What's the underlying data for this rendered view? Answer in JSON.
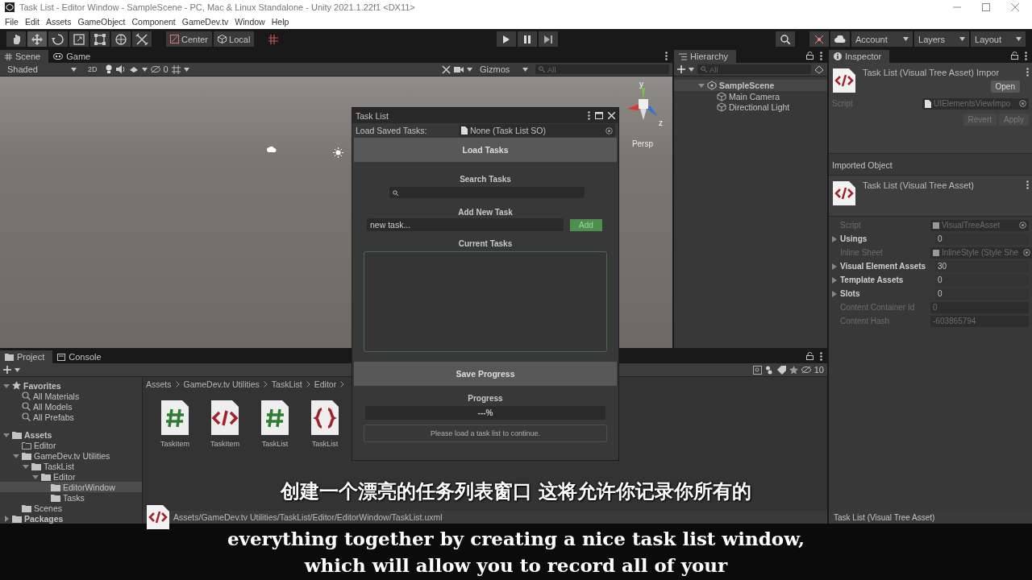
{
  "window": {
    "title": "Task List - Editor Window - SampleScene - PC, Mac & Linux Standalone - Unity 2021.1.22f1 <DX11>"
  },
  "menu": [
    "File",
    "Edit",
    "Assets",
    "GameObject",
    "Component",
    "GameDev.tv",
    "Window",
    "Help"
  ],
  "toolbar": {
    "tools": [
      {
        "selected": false
      },
      {
        "selected": true
      },
      {
        "selected": false
      },
      {
        "selected": false
      },
      {
        "selected": false
      },
      {
        "selected": false
      },
      {
        "selected": false
      }
    ],
    "pivot": "Center",
    "space": "Local",
    "account": "Account",
    "layers": "Layers",
    "layout": "Layout"
  },
  "scene_panel": {
    "tabs": [
      {
        "label": "Scene",
        "selected": true
      },
      {
        "label": "Game",
        "selected": false
      }
    ],
    "shading": "Shaded",
    "mode_2d": "2D",
    "hidden_count": "0",
    "gizmos": "Gizmos",
    "search_placeholder": "All",
    "gizmo_labels": [
      "y",
      "z"
    ],
    "projection": "Persp"
  },
  "hierarchy": {
    "title": "Hierarchy",
    "search_placeholder": "All",
    "items": [
      {
        "label": "SampleScene",
        "expanded": true,
        "children": [
          {
            "label": "Main Camera"
          },
          {
            "label": "Directional Light"
          }
        ]
      }
    ]
  },
  "inspector": {
    "title": "Inspector",
    "asset_title": "Task List (Visual Tree Asset) Impor",
    "open_button": "Open",
    "script_label": "Script",
    "script_value": "UIElementsViewImpo",
    "revert_button": "Revert",
    "apply_button": "Apply",
    "section": "Imported Object",
    "object_title": "Task List (Visual Tree Asset)",
    "properties": [
      {
        "label": "Script",
        "value": "VisualTreeAsset",
        "kind": "object",
        "disabled": true
      },
      {
        "label": "Usings",
        "value": "0",
        "kind": "foldout",
        "disabled": false
      },
      {
        "label": "Inline Sheet",
        "value": "InlineStyle (Style She",
        "kind": "object",
        "disabled": true
      },
      {
        "label": "Visual Element Assets",
        "value": "30",
        "kind": "foldout",
        "disabled": false
      },
      {
        "label": "Template Assets",
        "value": "0",
        "kind": "foldout",
        "disabled": false
      },
      {
        "label": "Slots",
        "value": "0",
        "kind": "foldout",
        "disabled": false
      },
      {
        "label": "Content Container Id",
        "value": "0",
        "kind": "field",
        "disabled": true
      },
      {
        "label": "Content Hash",
        "value": "-603865794",
        "kind": "field",
        "disabled": true
      }
    ],
    "footer": "Task List (Visual Tree Asset)"
  },
  "project": {
    "tabs": [
      {
        "label": "Project",
        "selected": true
      },
      {
        "label": "Console",
        "selected": false
      }
    ],
    "tree": [
      {
        "label": "Favorites",
        "kind": "favorites",
        "expanded": true,
        "selected": false,
        "children": [
          {
            "label": "All Materials",
            "kind": "search",
            "selected": false
          },
          {
            "label": "All Models",
            "kind": "search",
            "selected": false
          },
          {
            "label": "All Prefabs",
            "kind": "search",
            "selected": false
          }
        ]
      },
      {
        "label": "Assets",
        "kind": "root",
        "expanded": true,
        "selected": false,
        "children": [
          {
            "label": "Editor",
            "kind": "empty-folder",
            "selected": false
          },
          {
            "label": "GameDev.tv Utilities",
            "kind": "folder",
            "expanded": true,
            "selected": false,
            "children": [
              {
                "label": "TaskList",
                "kind": "folder",
                "expanded": true,
                "selected": false,
                "children": [
                  {
                    "label": "Editor",
                    "kind": "folder",
                    "expanded": true,
                    "selected": false,
                    "children": [
                      {
                        "label": "EditorWindow",
                        "kind": "folder",
                        "selected": true
                      },
                      {
                        "label": "Tasks",
                        "kind": "folder",
                        "selected": false
                      }
                    ]
                  }
                ]
              }
            ]
          },
          {
            "label": "Scenes",
            "kind": "folder",
            "selected": false
          }
        ]
      },
      {
        "label": "Packages",
        "kind": "root",
        "expanded": false,
        "selected": false
      }
    ],
    "breadcrumb": [
      "Assets",
      "GameDev.tv Utilities",
      "TaskList",
      "Editor"
    ],
    "hidden_count": "10",
    "files": [
      {
        "name": "TaskItem",
        "kind": "script"
      },
      {
        "name": "TaskItem",
        "kind": "uxml"
      },
      {
        "name": "TaskList",
        "kind": "script"
      },
      {
        "name": "TaskList",
        "kind": "uss"
      }
    ],
    "path": "Assets/GameDev.tv Utilities/TaskList/Editor/EditorWindow/TaskList.uxml"
  },
  "task_window": {
    "title": "Task List",
    "load_label": "Load Saved Tasks:",
    "load_value": "None (Task List SO)",
    "load_button": "Load Tasks",
    "search_label": "Search Tasks",
    "add_label": "Add New Task",
    "new_task_value": "new task...",
    "add_button": "Add",
    "list_label": "Current Tasks",
    "save_button": "Save Progress",
    "progress_label": "Progress",
    "progress": {
      "level": 0,
      "reading": "---%"
    },
    "message": "Please load a task list to continue."
  },
  "subtitles": [
    "创建一个漂亮的任务列表窗口 这将允许你记录你所有的",
    "everything together by creating a nice task list window,",
    "which will allow you to record all of your"
  ]
}
